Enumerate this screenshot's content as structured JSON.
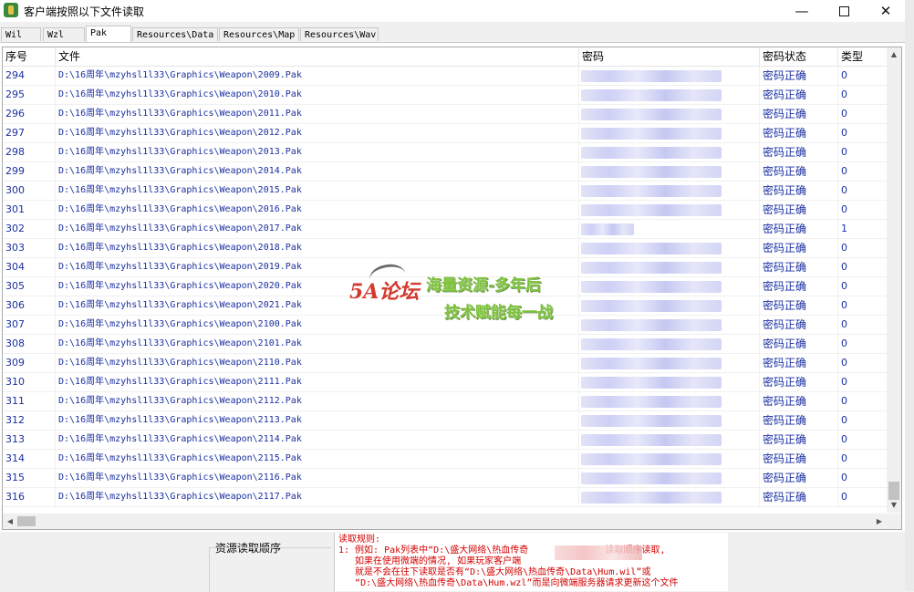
{
  "window": {
    "title": "客户端按照以下文件读取",
    "controls": {
      "minimize": "—",
      "close": "✕"
    }
  },
  "tabs": [
    "Wil",
    "Wzl",
    "Pak",
    "Resources\\Data",
    "Resources\\Map",
    "Resources\\Wav"
  ],
  "active_tab": "Pak",
  "table": {
    "columns": [
      "序号",
      "文件",
      "密码",
      "密码状态",
      "类型"
    ],
    "rows": [
      {
        "no": "294",
        "file": "D:\\16周年\\mzyhsl1l33\\Graphics\\Weapon\\2009.Pak",
        "status": "密码正确",
        "type": "0"
      },
      {
        "no": "295",
        "file": "D:\\16周年\\mzyhsl1l33\\Graphics\\Weapon\\2010.Pak",
        "status": "密码正确",
        "type": "0"
      },
      {
        "no": "296",
        "file": "D:\\16周年\\mzyhsl1l33\\Graphics\\Weapon\\2011.Pak",
        "status": "密码正确",
        "type": "0"
      },
      {
        "no": "297",
        "file": "D:\\16周年\\mzyhsl1l33\\Graphics\\Weapon\\2012.Pak",
        "status": "密码正确",
        "type": "0"
      },
      {
        "no": "298",
        "file": "D:\\16周年\\mzyhsl1l33\\Graphics\\Weapon\\2013.Pak",
        "status": "密码正确",
        "type": "0"
      },
      {
        "no": "299",
        "file": "D:\\16周年\\mzyhsl1l33\\Graphics\\Weapon\\2014.Pak",
        "status": "密码正确",
        "type": "0"
      },
      {
        "no": "300",
        "file": "D:\\16周年\\mzyhsl1l33\\Graphics\\Weapon\\2015.Pak",
        "status": "密码正确",
        "type": "0"
      },
      {
        "no": "301",
        "file": "D:\\16周年\\mzyhsl1l33\\Graphics\\Weapon\\2016.Pak",
        "status": "密码正确",
        "type": "0"
      },
      {
        "no": "302",
        "file": "D:\\16周年\\mzyhsl1l33\\Graphics\\Weapon\\2017.Pak",
        "status": "密码正确",
        "type": "1"
      },
      {
        "no": "303",
        "file": "D:\\16周年\\mzyhsl1l33\\Graphics\\Weapon\\2018.Pak",
        "status": "密码正确",
        "type": "0"
      },
      {
        "no": "304",
        "file": "D:\\16周年\\mzyhsl1l33\\Graphics\\Weapon\\2019.Pak",
        "status": "密码正确",
        "type": "0"
      },
      {
        "no": "305",
        "file": "D:\\16周年\\mzyhsl1l33\\Graphics\\Weapon\\2020.Pak",
        "status": "密码正确",
        "type": "0"
      },
      {
        "no": "306",
        "file": "D:\\16周年\\mzyhsl1l33\\Graphics\\Weapon\\2021.Pak",
        "status": "密码正确",
        "type": "0"
      },
      {
        "no": "307",
        "file": "D:\\16周年\\mzyhsl1l33\\Graphics\\Weapon\\2100.Pak",
        "status": "密码正确",
        "type": "0"
      },
      {
        "no": "308",
        "file": "D:\\16周年\\mzyhsl1l33\\Graphics\\Weapon\\2101.Pak",
        "status": "密码正确",
        "type": "0"
      },
      {
        "no": "309",
        "file": "D:\\16周年\\mzyhsl1l33\\Graphics\\Weapon\\2110.Pak",
        "status": "密码正确",
        "type": "0"
      },
      {
        "no": "310",
        "file": "D:\\16周年\\mzyhsl1l33\\Graphics\\Weapon\\2111.Pak",
        "status": "密码正确",
        "type": "0"
      },
      {
        "no": "311",
        "file": "D:\\16周年\\mzyhsl1l33\\Graphics\\Weapon\\2112.Pak",
        "status": "密码正确",
        "type": "0"
      },
      {
        "no": "312",
        "file": "D:\\16周年\\mzyhsl1l33\\Graphics\\Weapon\\2113.Pak",
        "status": "密码正确",
        "type": "0"
      },
      {
        "no": "313",
        "file": "D:\\16周年\\mzyhsl1l33\\Graphics\\Weapon\\2114.Pak",
        "status": "密码正确",
        "type": "0"
      },
      {
        "no": "314",
        "file": "D:\\16周年\\mzyhsl1l33\\Graphics\\Weapon\\2115.Pak",
        "status": "密码正确",
        "type": "0"
      },
      {
        "no": "315",
        "file": "D:\\16周年\\mzyhsl1l33\\Graphics\\Weapon\\2116.Pak",
        "status": "密码正确",
        "type": "0"
      },
      {
        "no": "316",
        "file": "D:\\16周年\\mzyhsl1l33\\Graphics\\Weapon\\2117.Pak",
        "status": "密码正确",
        "type": "0"
      }
    ]
  },
  "bottom": {
    "order_label": "资源读取顺序",
    "rules": "读取规则:\n1: 例如: Pak列表中“D:\\盛大网络\\热血传奇              读取顺序读取,\n   如果在使用微端的情况, 如果玩家客户端\n   就是不会在往下读取是否有“D:\\盛大网络\\热血传奇\\Data\\Hum.wil”或\n   “D:\\盛大网络\\热血传奇\\Data\\Hum.wzl”而是向微端服务器请求更新这个文件"
  },
  "watermark": {
    "logo": "5A论坛",
    "line1": "海量资源-多年后",
    "line2": "技术赋能每一战"
  },
  "colors": {
    "link_blue": "#1a2fa0",
    "rules_red": "#d40000",
    "watermark_green": "#7cc23a"
  }
}
